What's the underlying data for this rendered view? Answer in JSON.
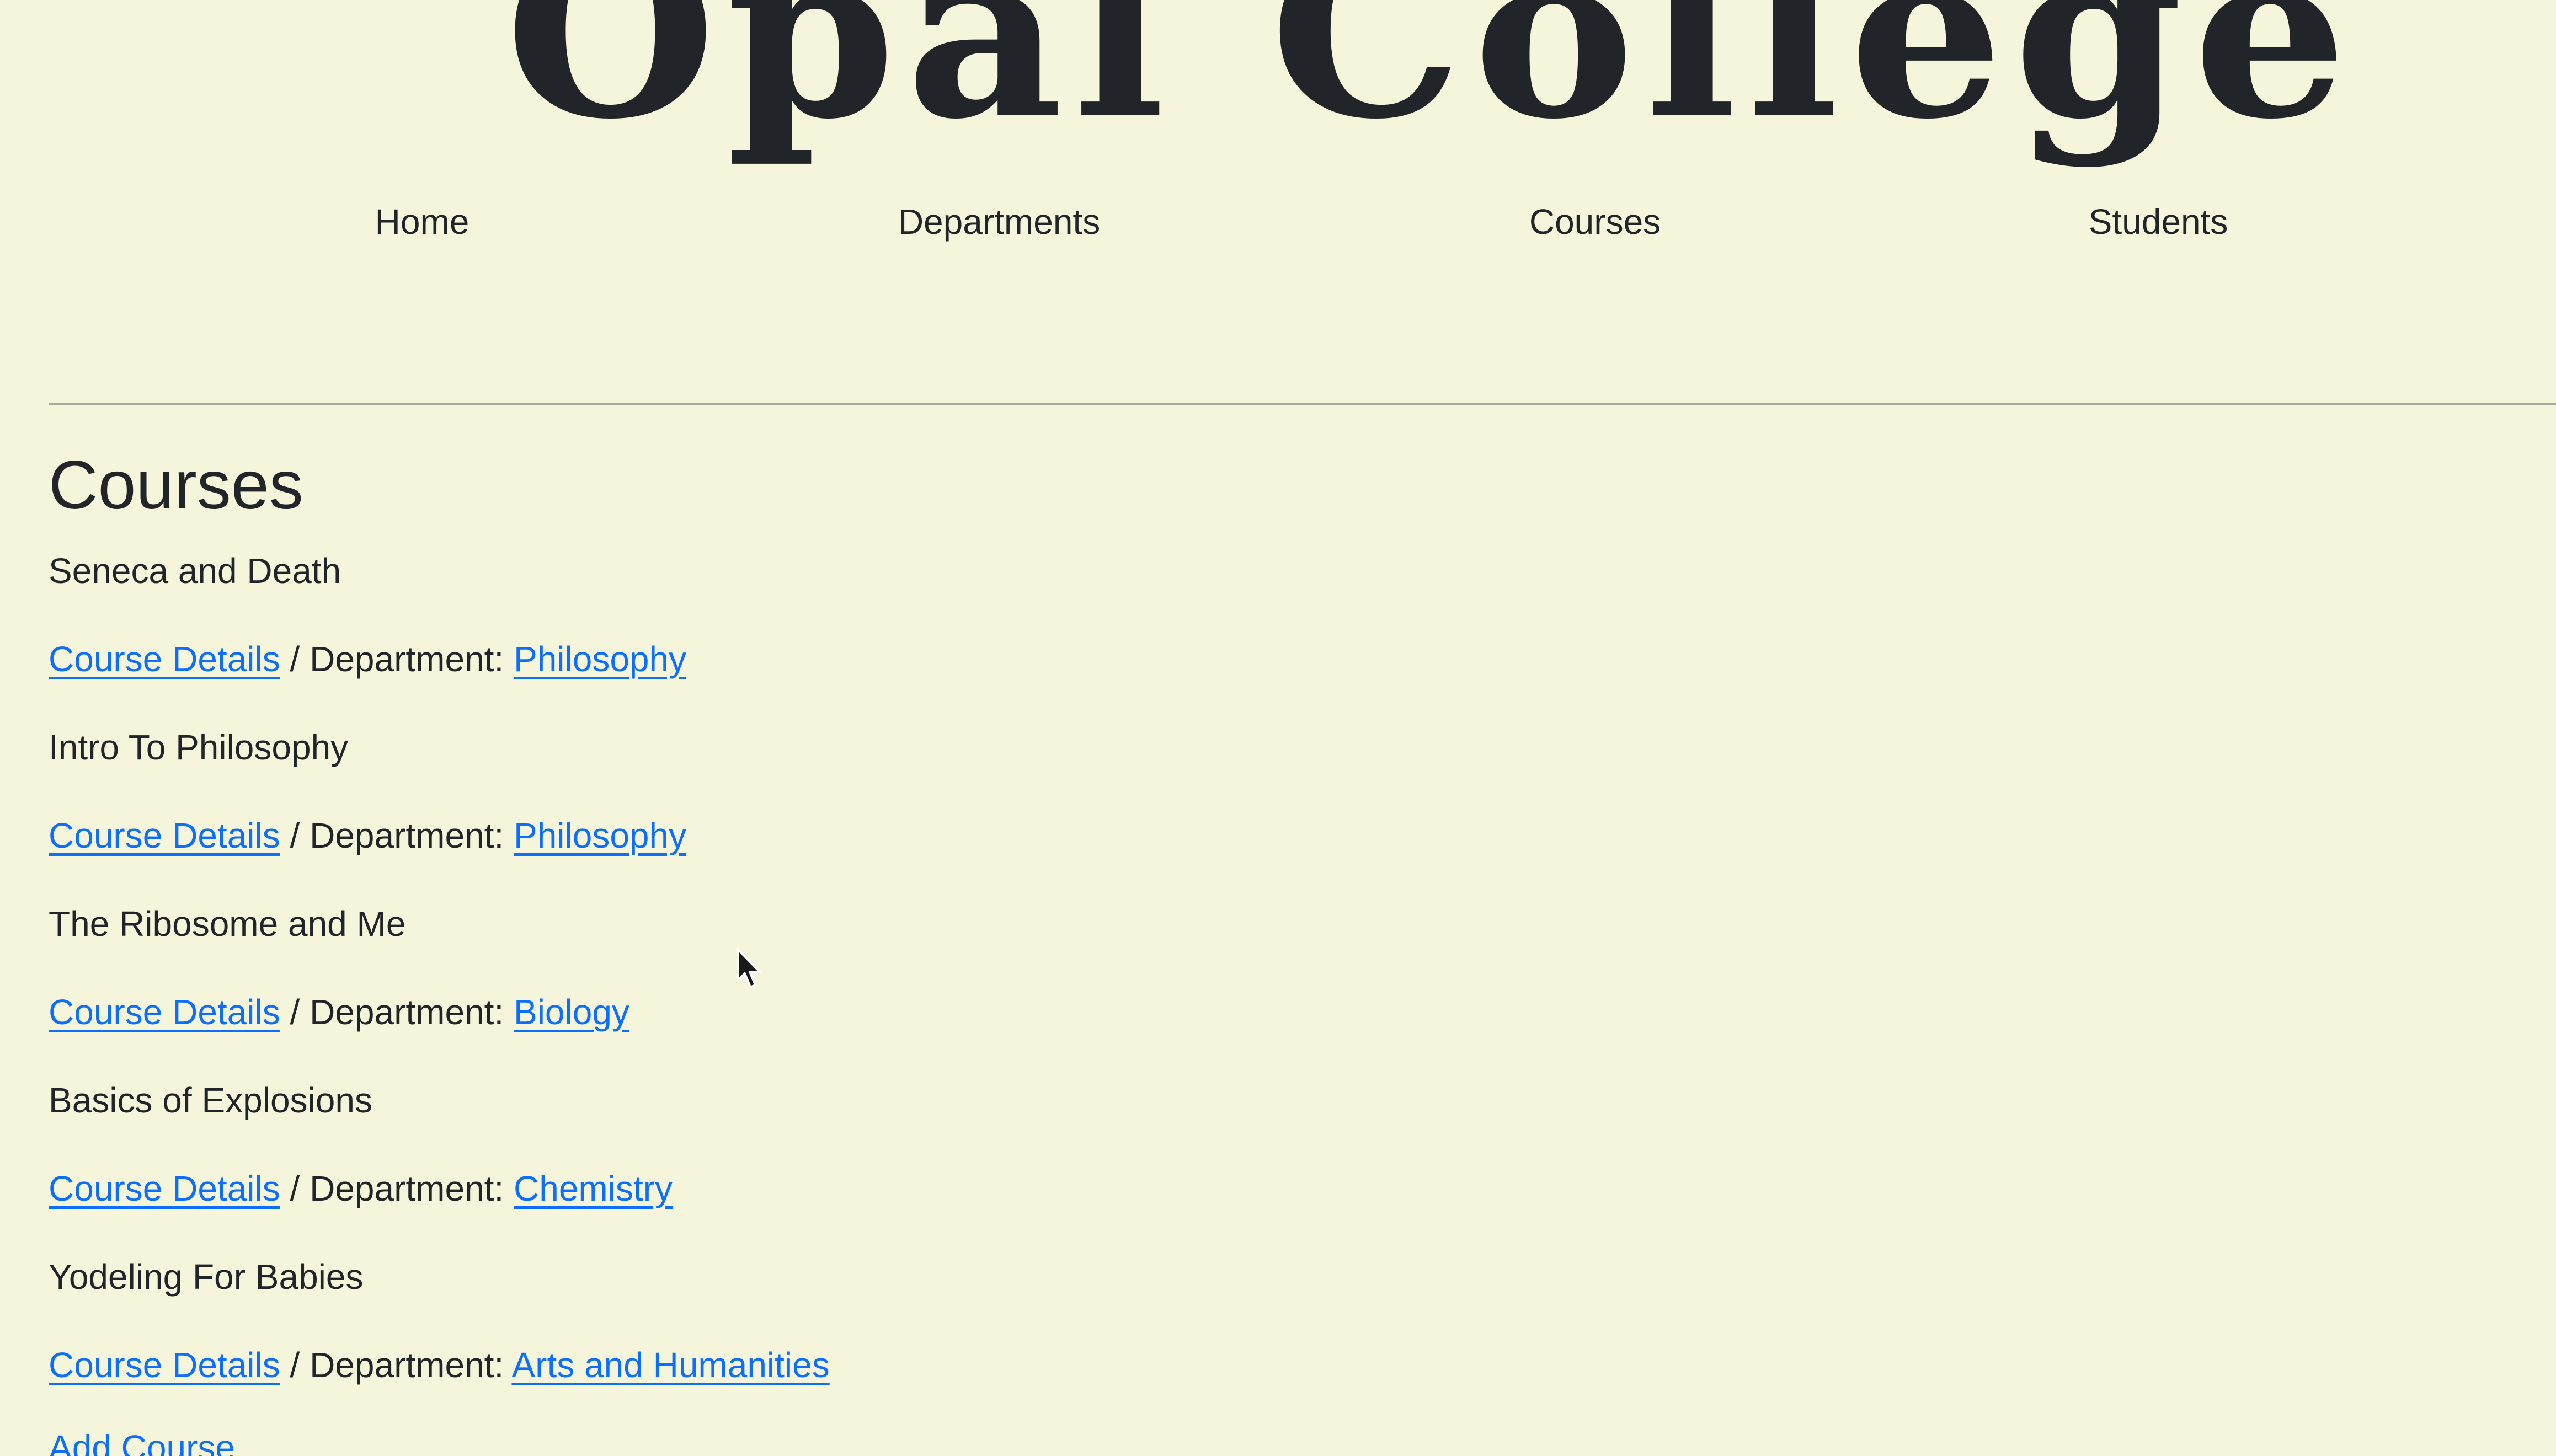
{
  "brand": {
    "logo_text": "Opal College"
  },
  "nav": {
    "items": [
      {
        "label": "Home"
      },
      {
        "label": "Departments"
      },
      {
        "label": "Courses"
      },
      {
        "label": "Students"
      }
    ]
  },
  "main": {
    "title": "Courses",
    "courses": [
      {
        "name": "Seneca and Death",
        "details_label": "Course Details",
        "separator": " / Department: ",
        "department": "Philosophy"
      },
      {
        "name": "Intro To Philosophy",
        "details_label": "Course Details",
        "separator": " / Department: ",
        "department": "Philosophy"
      },
      {
        "name": "The Ribosome and Me",
        "details_label": "Course Details",
        "separator": " / Department: ",
        "department": "Biology"
      },
      {
        "name": "Basics of Explosions",
        "details_label": "Course Details",
        "separator": " / Department: ",
        "department": "Chemistry"
      },
      {
        "name": "Yodeling For Babies",
        "details_label": "Course Details",
        "separator": " / Department: ",
        "department": "Arts and Humanities"
      }
    ],
    "add_course_label": "Add Course"
  },
  "colors": {
    "background": "#f5f5dc",
    "text": "#212529",
    "link": "#0d6efd"
  },
  "icons": {
    "cursor": "mouse-pointer-icon"
  }
}
